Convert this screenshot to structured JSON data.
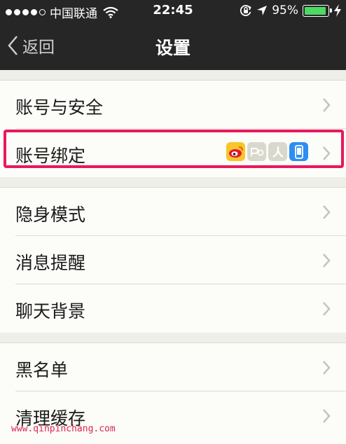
{
  "status_bar": {
    "carrier": "中国联通",
    "time": "22:45",
    "battery_percent": "95%",
    "battery_level": 0.95,
    "battery_color": "#4cd964"
  },
  "nav": {
    "back_label": "返回",
    "title": "设置"
  },
  "settings": {
    "account_security": "账号与安全",
    "account_binding": "账号绑定",
    "stealth_mode": "隐身模式",
    "message_reminder": "消息提醒",
    "chat_background": "聊天背景",
    "blacklist": "黑名单",
    "clear_cache": "清理缓存"
  },
  "binding_icons": [
    "weibo-icon",
    "pengyou-icon",
    "renren-icon",
    "phone-icon"
  ],
  "highlight_color": "#e8185e",
  "watermark": "www.qinpinchang.com"
}
